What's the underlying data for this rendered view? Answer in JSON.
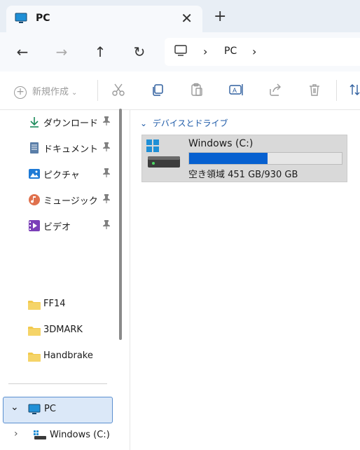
{
  "tab": {
    "title": "PC",
    "close": "✕",
    "new": "+"
  },
  "nav": {
    "back": "←",
    "forward": "→",
    "up": "↑",
    "refresh": "↻"
  },
  "address": {
    "sep1": "›",
    "crumb": "PC",
    "sep2": "›"
  },
  "toolbar": {
    "new_label": "新規作成",
    "new_chevron": "⌄"
  },
  "sidebar": {
    "pinned": [
      {
        "label": "ダウンロード",
        "icon": "download-icon"
      },
      {
        "label": "ドキュメント",
        "icon": "document-icon"
      },
      {
        "label": "ピクチャ",
        "icon": "picture-icon"
      },
      {
        "label": "ミュージック",
        "icon": "music-icon"
      },
      {
        "label": "ビデオ",
        "icon": "video-icon"
      }
    ],
    "folders": [
      {
        "label": "FF14"
      },
      {
        "label": "3DMARK"
      },
      {
        "label": "Handbrake"
      }
    ],
    "pc": {
      "label": "PC",
      "chevron": "⌄"
    },
    "drive": {
      "label": "Windows (C:)",
      "chevron": "›"
    }
  },
  "main": {
    "section_chevron": "⌄",
    "section_title": "デバイスとドライブ",
    "drive": {
      "name": "Windows (C:)",
      "free_text": "空き領域 451 GB/930 GB",
      "used_fraction": 0.515
    }
  },
  "colors": {
    "accent": "#0660d0",
    "folder": "#f2c94c"
  }
}
